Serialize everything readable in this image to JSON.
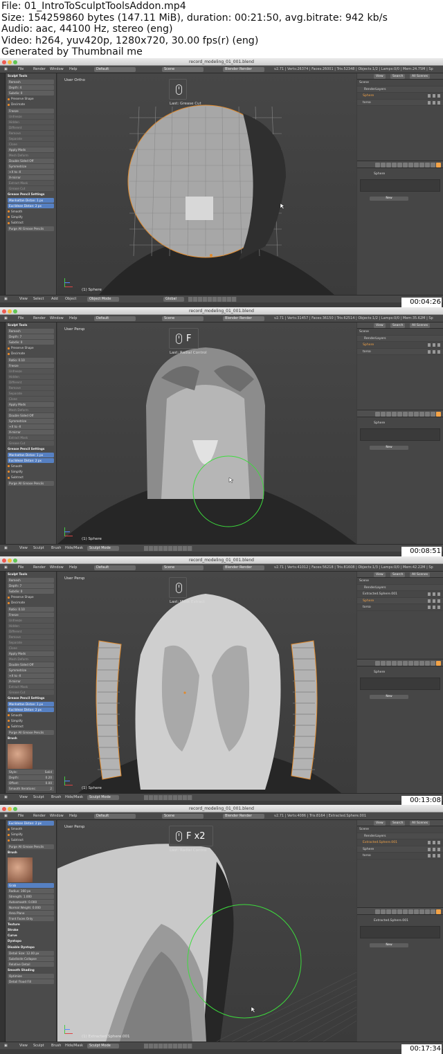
{
  "meta": {
    "file": "File: 01_IntroToSculptToolsAddon.mp4",
    "size": "Size: 154259860 bytes (147.11 MiB), duration: 00:21:50, avg.bitrate: 942 kb/s",
    "audio": "Audio: aac, 44100 Hz, stereo (eng)",
    "video": "Video: h264, yuv420p, 1280x720, 30.00 fps(r) (eng)",
    "generated": "Generated by Thumbnail me"
  },
  "colors": {
    "accent_orange": "#f3a347",
    "selection_blue": "#5680c2",
    "radial_circle": "#3ddc3d",
    "viewport_bg": "#444444"
  },
  "frames": [
    {
      "window_title": "record_modeling_01_001.blend",
      "menu": [
        "File",
        "Render",
        "Window",
        "Help"
      ],
      "layout": "Default",
      "scene": "Scene",
      "engine": "Blender Render",
      "stats": "v2.71 | Verts:26374 | Faces:26001 | Tris:52348 | Objects:1/2 | Lamps:0/0 | Mem:24.75M | Sp",
      "tool_items": [
        "Sculpt Tools",
        "Remesh",
        "Depth: 4",
        "Subdiv: 0",
        "Preserve Shape",
        "Decimate",
        "Freeze",
        "Unfreeze",
        "Hidden",
        "Different",
        "Remove",
        "Separate",
        "Clone",
        "Apply Mods",
        "Mesh Deform",
        "Double Sided Off",
        "Symmetrize",
        "+X to -X",
        "X-mirror",
        "Extract Mask",
        "Grease Cut",
        "Grease Pencil Settings",
        "Manhattan Distan: 1 px",
        "Euclidean Distan: 2 px",
        "Smooth",
        "Simplify",
        "Subtract",
        "Purge All Grease Pencils"
      ],
      "view_label": "User Ortho",
      "key_text": "",
      "last_op": "Last: Grease Cut",
      "object_label": "(1) Sphere",
      "bottom": [
        "View",
        "Select",
        "Add",
        "Object"
      ],
      "mode": "Object Mode",
      "orientation": "Global",
      "outliner": [
        "Scene",
        "RenderLayers",
        "Sphere",
        "torso"
      ],
      "outliner_tabs": [
        "View",
        "Search",
        "All Scenes"
      ],
      "prop_object": "Sphere",
      "new_label": "New",
      "timestamp": "00:04:26"
    },
    {
      "window_title": "record_modeling_01_001.blend",
      "menu": [
        "File",
        "Render",
        "Window",
        "Help"
      ],
      "layout": "Default",
      "scene": "Scene",
      "engine": "Blender Render",
      "stats": "v2.71 | Verts:31457 | Faces:36150 | Tris:62514 | Objects:1/2 | Lamps:0/0 | Mem:35.62M | Sp",
      "tool_items": [
        "Sculpt Tools",
        "Remesh",
        "Depth: 7",
        "Subdiv: 0",
        "Preserve Shape",
        "Decimate",
        "Ratio: 0.10",
        "Freeze",
        "Unfreeze",
        "Hidden",
        "Different",
        "Remove",
        "Separate",
        "Clone",
        "Apply Mods",
        "Mesh Deform",
        "Double Sided Off",
        "Symmetrize",
        "+X to -X",
        "X-mirror",
        "Extract Mask",
        "Grease Cut",
        "Grease Pencil Settings",
        "Manhattan Distan: 1 px",
        "Euclidean Distan: 2 px",
        "Smooth",
        "Simplify",
        "Subtract",
        "Purge All Grease Pencils"
      ],
      "view_label": "User Persp",
      "key_text": "F",
      "last_op": "Last: Radial Control",
      "object_label": "(1) Sphere",
      "bottom": [
        "View",
        "Sculpt",
        "Brush",
        "Hide/Mask"
      ],
      "mode": "Sculpt Mode",
      "orientation": "",
      "outliner": [
        "Scene",
        "RenderLayers",
        "Sphere",
        "torso"
      ],
      "outliner_tabs": [
        "View",
        "Search",
        "All Scenes"
      ],
      "prop_object": "Sphere",
      "new_label": "New",
      "timestamp": "00:08:51"
    },
    {
      "window_title": "record_modeling_01_001.blend",
      "menu": [
        "File",
        "Render",
        "Window",
        "Help"
      ],
      "layout": "Default",
      "scene": "Scene",
      "engine": "Blender Render",
      "stats": "v2.71 | Verts:41012 | Faces:56218 | Tris:81608 | Objects:1/3 | Lamps:0/0 | Mem:42.22M | Sp",
      "tool_items": [
        "Sculpt Tools",
        "Remesh",
        "Depth: 7",
        "Subdiv: 0",
        "Preserve Shape",
        "Decimate",
        "Ratio: 0.10",
        "Freeze",
        "Unfreeze",
        "Hidden",
        "Different",
        "Remove",
        "Separate",
        "Clone",
        "Apply Mods",
        "Mesh Deform",
        "Double Sided Off",
        "Symmetrize",
        "+X to -X",
        "X-mirror",
        "Extract Mask",
        "Grease Cut",
        "Grease Pencil Settings",
        "Manhattan Distan: 1 px",
        "Euclidean Distan: 2 px",
        "Smooth",
        "Simplify",
        "Subtract",
        "Purge All Grease Pencils",
        "Brush"
      ],
      "brush_rows": [
        {
          "label": "Style:",
          "value": "Solid"
        },
        {
          "label": "Depth:",
          "value": "0.20"
        },
        {
          "label": "Offset:",
          "value": "0.00"
        },
        {
          "label": "Smooth Iterations:",
          "value": "2"
        }
      ],
      "view_label": "User Persp",
      "key_text": "",
      "last_op": "Last: Mask Extract",
      "object_label": "(1) Sphere",
      "bottom": [
        "View",
        "Sculpt",
        "Brush",
        "Hide/Mask"
      ],
      "mode": "Sculpt Mode",
      "orientation": "",
      "outliner": [
        "Scene",
        "RenderLayers",
        "Extracted.Sphere.001",
        "Sphere",
        "torso"
      ],
      "outliner_tabs": [
        "View",
        "Search",
        "All Scenes"
      ],
      "prop_object": "Sphere",
      "new_label": "New",
      "timestamp": "00:13:08"
    },
    {
      "window_title": "record_modeling_01_001.blend",
      "menu": [
        "File",
        "Render",
        "Window",
        "Help"
      ],
      "layout": "Default",
      "scene": "Scene",
      "engine": "Blender Render",
      "stats": "v2.71 | Verts:4086 | Tris:8164 | Extracted.Sphere.001",
      "tool_items": [
        "Euclidean Distan: 2 px",
        "Smooth",
        "Simplify",
        "Subtract",
        "Purge All Grease Pencils",
        "Brush",
        "Grab",
        "Radius: 160 px",
        "Strength: 1.000",
        "Autosmooth: 0.000",
        "Normal Weight: 0.000",
        "Area Plane",
        "Front Faces Only",
        "Texture",
        "Stroke",
        "Curve",
        "Dyntopo",
        "Disable Dyntopo",
        "Detail Size: 12.00 px",
        "Subdivide Collapse",
        "Relative Detail",
        "Smooth Shading",
        "Optimize",
        "Detail Flood Fill"
      ],
      "view_label": "User Persp",
      "key_text": "F x2",
      "last_op": "Last: Radial Control",
      "object_label": "(1) Extracted.Sphere.001",
      "bottom": [
        "View",
        "Sculpt",
        "Brush",
        "Hide/Mask"
      ],
      "mode": "Sculpt Mode",
      "orientation": "",
      "outliner": [
        "Scene",
        "RenderLayers",
        "Extracted.Sphere.001",
        "Sphere",
        "torso"
      ],
      "outliner_tabs": [
        "View",
        "Search",
        "All Scenes"
      ],
      "prop_object": "Extracted.Sphere.001",
      "new_label": "New",
      "timestamp": "00:17:34"
    }
  ]
}
